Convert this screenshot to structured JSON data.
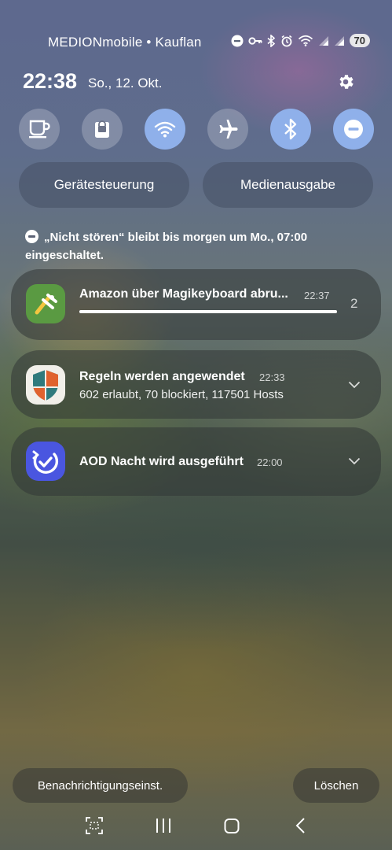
{
  "status": {
    "carrier": "MEDIONmobile • Kauflan",
    "battery": "70",
    "icons": [
      "dnd-icon",
      "key-icon",
      "bluetooth-icon",
      "alarm-icon",
      "wifi-icon",
      "signal-icon",
      "signal-icon",
      "battery-icon"
    ]
  },
  "header": {
    "time": "22:38",
    "date": "So., 12. Okt."
  },
  "quick_settings": [
    {
      "name": "Kaffeetasse",
      "icon": "coffee-cup-icon",
      "active": false
    },
    {
      "name": "Sicherer Ordner",
      "icon": "lock-icon",
      "active": false
    },
    {
      "name": "WLAN",
      "icon": "wifi-icon",
      "active": true
    },
    {
      "name": "Flugmodus",
      "icon": "airplane-icon",
      "active": false
    },
    {
      "name": "Bluetooth",
      "icon": "bluetooth-icon",
      "active": true
    },
    {
      "name": "Nicht stören",
      "icon": "dnd-icon",
      "active": true
    }
  ],
  "pills": {
    "device_control": "Gerätesteuerung",
    "media_output": "Medienausgabe"
  },
  "dnd_notice": {
    "line1": "„Nicht stören“ bleibt bis morgen um Mo., 07:00",
    "line2": "eingeschaltet."
  },
  "notifications": [
    {
      "title": "Amazon über Magikeyboard abru...",
      "time": "22:37",
      "count": "2",
      "progress": 1.0,
      "icon": "magikeyboard-icon"
    },
    {
      "title": "Regeln werden angewendet",
      "time": "22:33",
      "text": "602 erlaubt, 70 blockiert, 117501 Hosts",
      "icon": "shield-icon"
    },
    {
      "title": "AOD Nacht wird ausgeführt",
      "time": "22:00",
      "icon": "check-clock-icon"
    }
  ],
  "footer": {
    "settings": "Benachrichtigungseinst.",
    "clear": "Löschen"
  },
  "colors": {
    "toggle_on": "#8fb0ea",
    "progress": "#ffffff"
  }
}
